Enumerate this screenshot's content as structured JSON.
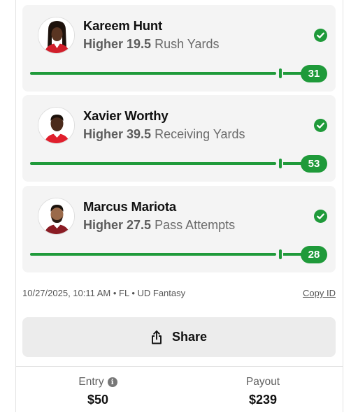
{
  "picks": [
    {
      "player": "Kareem Hunt",
      "direction": "Higher",
      "line": "19.5",
      "stat": "Rush Yards",
      "result": "31",
      "status": "won",
      "jersey_color": "#d11f2b",
      "skin_color": "#5a3522",
      "hair_style": "locs"
    },
    {
      "player": "Xavier Worthy",
      "direction": "Higher",
      "line": "39.5",
      "stat": "Receiving Yards",
      "result": "53",
      "status": "won",
      "jersey_color": "#e01f2d",
      "skin_color": "#4b2b1c",
      "hair_style": "short"
    },
    {
      "player": "Marcus Mariota",
      "direction": "Higher",
      "line": "27.5",
      "stat": "Pass Attempts",
      "result": "28",
      "status": "won",
      "jersey_color": "#8a1c24",
      "skin_color": "#9a6a4a",
      "hair_style": "beard"
    }
  ],
  "meta": {
    "info": "10/27/2025, 10:11 AM • FL • UD Fantasy",
    "copy_id_label": "Copy ID"
  },
  "share": {
    "label": "Share",
    "icon": "share-icon"
  },
  "footer": {
    "entry_label": "Entry",
    "entry_value": "$50",
    "payout_label": "Payout",
    "payout_value": "$239"
  },
  "colors": {
    "accent_green": "#1f9a3a",
    "card_bg": "#f4f4f4",
    "button_bg": "#ececec"
  }
}
